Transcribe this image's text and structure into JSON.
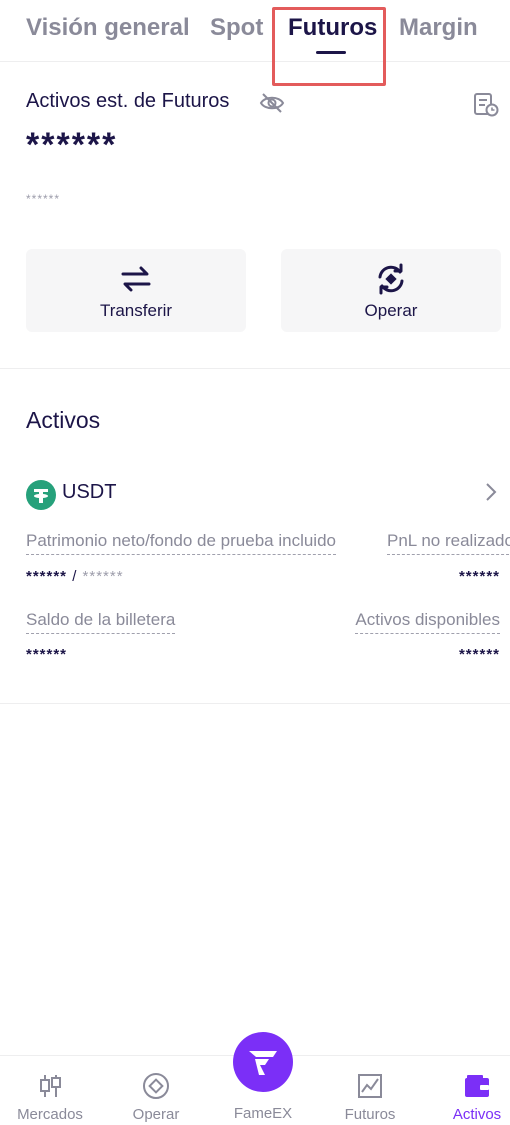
{
  "tabs": [
    {
      "label": "Visión general",
      "active": false
    },
    {
      "label": "Spot",
      "active": false
    },
    {
      "label": "Futuros",
      "active": true
    },
    {
      "label": "Margin",
      "active": false
    }
  ],
  "header": {
    "assets_label": "Activos est. de Futuros",
    "total_masked": "******",
    "sub_masked": "******"
  },
  "actions": {
    "transfer_label": "Transferir",
    "trade_label": "Operar"
  },
  "section": {
    "title": "Activos"
  },
  "asset": {
    "name": "USDT",
    "equity_label": "Patrimonio neto/fondo de prueba incluido",
    "pnl_label": "PnL no realizado",
    "equity_value": "******",
    "equity_separator": "/",
    "equity_value_secondary": "******",
    "pnl_value": "******",
    "wallet_label": "Saldo de la billetera",
    "available_label": "Activos disponibles",
    "wallet_value": "******",
    "available_value": "******"
  },
  "bottom_nav": {
    "items": [
      {
        "label": "Mercados",
        "icon": "candlestick-icon",
        "active": false
      },
      {
        "label": "Operar",
        "icon": "trade-circle-icon",
        "active": false
      },
      {
        "label": "FameEX",
        "icon": "fameex-logo-icon",
        "active": false
      },
      {
        "label": "Futuros",
        "icon": "futures-chart-icon",
        "active": false
      },
      {
        "label": "Activos",
        "icon": "wallet-icon",
        "active": true
      }
    ]
  },
  "colors": {
    "primary_text": "#1c1548",
    "muted_text": "#8a8a99",
    "accent": "#7b2ff7",
    "usdt_green": "#26a17b",
    "highlight_red": "#e35b5b"
  }
}
